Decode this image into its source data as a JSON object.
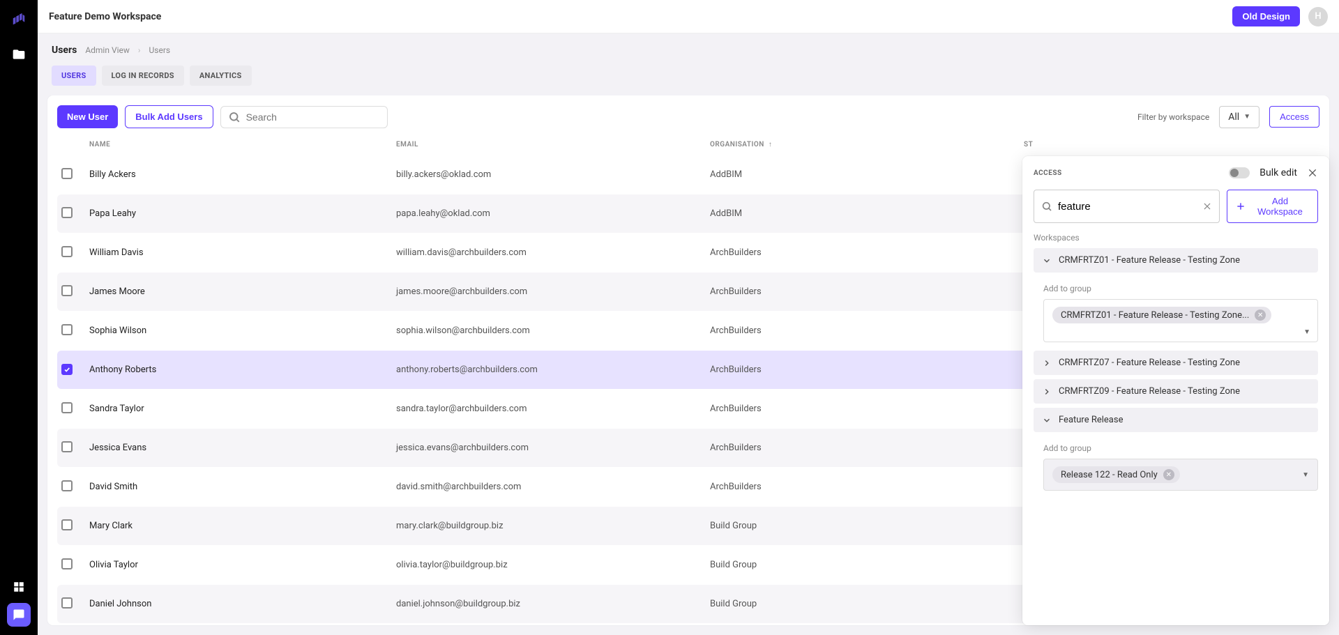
{
  "header": {
    "workspace_title": "Feature Demo Workspace",
    "old_design_label": "Old Design",
    "avatar_letter": "H"
  },
  "breadcrumb": {
    "page_label": "Users",
    "items": [
      "Admin View",
      "Users"
    ]
  },
  "tabs": [
    {
      "label": "USERS",
      "active": true
    },
    {
      "label": "LOG IN RECORDS",
      "active": false
    },
    {
      "label": "ANALYTICS",
      "active": false
    }
  ],
  "toolbar": {
    "new_user": "New User",
    "bulk_add": "Bulk Add Users",
    "search_placeholder": "Search",
    "filter_label": "Filter by workspace",
    "filter_value": "All",
    "access_label": "Access"
  },
  "columns": {
    "name": "NAME",
    "email": "EMAIL",
    "organisation": "ORGANISATION",
    "status": "ST"
  },
  "rows": [
    {
      "selected": false,
      "name": "Billy Ackers",
      "email": "billy.ackers@oklad.com",
      "org": "AddBIM"
    },
    {
      "selected": false,
      "name": "Papa Leahy",
      "email": "papa.leahy@oklad.com",
      "org": "AddBIM"
    },
    {
      "selected": false,
      "name": "William Davis",
      "email": "william.davis@archbuilders.com",
      "org": "ArchBuilders"
    },
    {
      "selected": false,
      "name": "James Moore",
      "email": "james.moore@archbuilders.com",
      "org": "ArchBuilders"
    },
    {
      "selected": false,
      "name": "Sophia Wilson",
      "email": "sophia.wilson@archbuilders.com",
      "org": "ArchBuilders"
    },
    {
      "selected": true,
      "name": "Anthony Roberts",
      "email": "anthony.roberts@archbuilders.com",
      "org": "ArchBuilders"
    },
    {
      "selected": false,
      "name": "Sandra Taylor",
      "email": "sandra.taylor@archbuilders.com",
      "org": "ArchBuilders"
    },
    {
      "selected": false,
      "name": "Jessica Evans",
      "email": "jessica.evans@archbuilders.com",
      "org": "ArchBuilders"
    },
    {
      "selected": false,
      "name": "David Smith",
      "email": "david.smith@archbuilders.com",
      "org": "ArchBuilders"
    },
    {
      "selected": false,
      "name": "Mary Clark",
      "email": "mary.clark@buildgroup.biz",
      "org": "Build Group"
    },
    {
      "selected": false,
      "name": "Olivia Taylor",
      "email": "olivia.taylor@buildgroup.biz",
      "org": "Build Group"
    },
    {
      "selected": false,
      "name": "Daniel Johnson",
      "email": "daniel.johnson@buildgroup.biz",
      "org": "Build Group"
    }
  ],
  "panel": {
    "title": "ACCESS",
    "bulk_edit_label": "Bulk edit",
    "search_value": "feature",
    "add_workspace_label": "Add Workspace",
    "workspaces_label": "Workspaces",
    "add_to_group_label": "Add to group",
    "items": [
      {
        "label": "CRMFRTZ01 - Feature Release - Testing Zone",
        "expanded": true,
        "chip": "CRMFRTZ01 - Feature Release - Testing Zone..."
      },
      {
        "label": "CRMFRTZ07 - Feature Release - Testing Zone",
        "expanded": false
      },
      {
        "label": "CRMFRTZ09 - Feature Release - Testing Zone",
        "expanded": false
      },
      {
        "label": "Feature Release",
        "expanded": true,
        "chip": "Release 122 - Read Only"
      }
    ]
  }
}
